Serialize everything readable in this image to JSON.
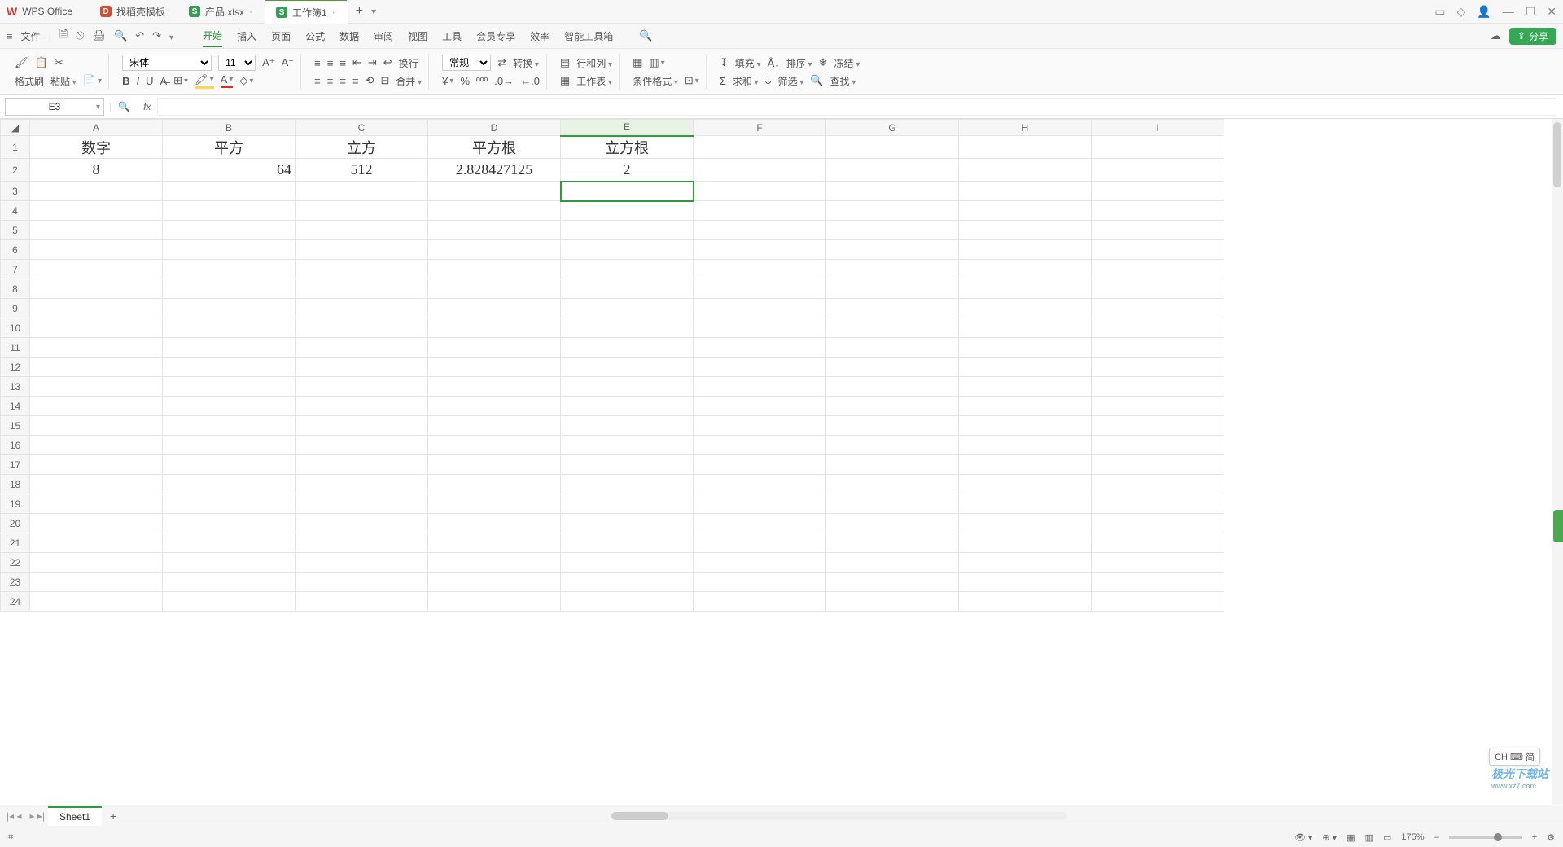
{
  "title": {
    "brand": "WPS Office",
    "tabs": [
      {
        "icon": "d",
        "label": "找稻壳模板"
      },
      {
        "icon": "s",
        "label": "产品.xlsx"
      },
      {
        "icon": "s",
        "label": "工作簿1",
        "active": true
      }
    ]
  },
  "menu": {
    "file": "文件",
    "tabs": [
      "开始",
      "插入",
      "页面",
      "公式",
      "数据",
      "审阅",
      "视图",
      "工具",
      "会员专享",
      "效率",
      "智能工具箱"
    ],
    "activeIndex": 0,
    "share": "分享"
  },
  "ribbon": {
    "clipboard": {
      "format": "格式刷",
      "paste": "粘贴"
    },
    "font": {
      "name": "宋体",
      "size": "11"
    },
    "align": {
      "wrap": "换行",
      "merge": "合并"
    },
    "number": {
      "format": "常规",
      "convert": "转换"
    },
    "cells": {
      "rowcol": "行和列",
      "sheet": "工作表",
      "cond": "条件格式"
    },
    "edit": {
      "fill": "填充",
      "sort": "排序",
      "freeze": "冻结",
      "sum": "求和",
      "filter": "筛选",
      "find": "查找"
    }
  },
  "namebox": {
    "ref": "E3",
    "fx": "fx"
  },
  "grid": {
    "cols": [
      "A",
      "B",
      "C",
      "D",
      "E",
      "F",
      "G",
      "H",
      "I"
    ],
    "rows": 24,
    "data": {
      "1": {
        "A": "数字",
        "B": "平方",
        "C": "立方",
        "D": "平方根",
        "E": "立方根"
      },
      "2": {
        "A": "8",
        "B": "64",
        "C": "512",
        "D": "2.828427125",
        "E": "2"
      }
    },
    "selected": "E3",
    "highlightCol": "E"
  },
  "sheet": {
    "name": "Sheet1"
  },
  "status": {
    "zoom": "175%",
    "ime": "CH ⌨ 简"
  },
  "watermark": {
    "t1": "极光下载站",
    "t2": "www.xz7.com"
  }
}
